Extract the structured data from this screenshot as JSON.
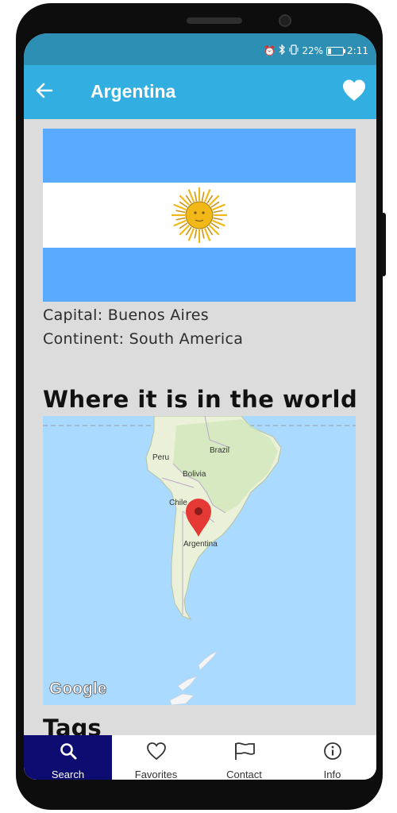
{
  "status_bar": {
    "battery": "22%",
    "battery_level": 0.22,
    "time": "2:11",
    "icons": [
      "alarm-icon",
      "bluetooth-icon",
      "vibrate-icon",
      "battery-icon"
    ]
  },
  "app_bar": {
    "title": "Argentina",
    "back_icon": "arrow-left-icon",
    "favorite_icon": "heart-filled-icon",
    "color": "#33aee0"
  },
  "country": {
    "capital": "Capital: Buenos Aires",
    "continent": "Continent: South America",
    "flag_colors": {
      "blue": "#5aabff",
      "white": "#ffffff",
      "sun": "#f2b818"
    }
  },
  "map_section": {
    "heading": "Where it is in the world",
    "labels": {
      "brazil": "Brazil",
      "peru": "Peru",
      "bolivia": "Bolivia",
      "chile": "Chile",
      "argentina": "Argentina"
    },
    "attribution": "Google",
    "water_color": "#aadaff",
    "land_color": "#eaf1d8",
    "pin_color": "#e53935"
  },
  "next_section": {
    "heading": "Tags"
  },
  "bottom_nav": {
    "active": "search",
    "active_color": "#0d0c70",
    "items": [
      {
        "label": "Search",
        "icon": "search-icon"
      },
      {
        "label": "Favorites",
        "icon": "heart-outline-icon"
      },
      {
        "label": "Contact",
        "icon": "flag-icon"
      },
      {
        "label": "Info",
        "icon": "info-icon"
      }
    ]
  }
}
